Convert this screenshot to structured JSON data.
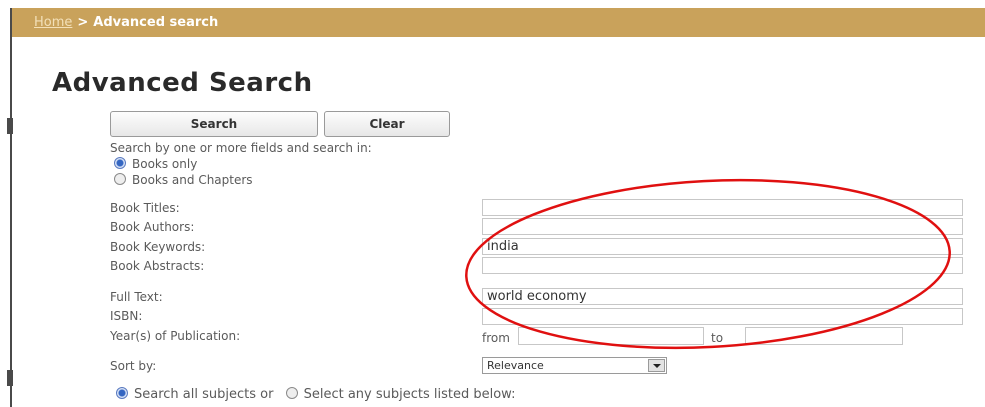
{
  "breadcrumb": {
    "home": "Home",
    "separator": ">",
    "current": "Advanced search"
  },
  "page_title": "Advanced Search",
  "buttons": {
    "search": "Search",
    "clear": "Clear"
  },
  "search_in": {
    "label": "Search by one or more fields and search in:",
    "options": [
      "Books only",
      "Books and Chapters"
    ],
    "selected": "Books only"
  },
  "fields": {
    "book_titles": {
      "label": "Book Titles:",
      "value": ""
    },
    "book_authors": {
      "label": "Book Authors:",
      "value": ""
    },
    "book_keywords": {
      "label": "Book Keywords:",
      "value": "india"
    },
    "book_abstracts": {
      "label": "Book Abstracts:",
      "value": ""
    },
    "full_text": {
      "label": "Full Text:",
      "value": "world economy"
    },
    "isbn": {
      "label": "ISBN:",
      "value": ""
    }
  },
  "year": {
    "label": "Year(s) of Publication:",
    "from_label": "from",
    "to_label": "to",
    "from_value": "",
    "to_value": ""
  },
  "sort": {
    "label": "Sort by:",
    "selected": "Relevance"
  },
  "subjects": {
    "option_all": "Search all subjects or",
    "option_select": "Select any subjects listed below:",
    "selected": "Search all subjects or"
  },
  "colors": {
    "breadcrumb_bg": "#c9a25b",
    "annotation": "#e01010",
    "radio_on": "#3466c2"
  }
}
